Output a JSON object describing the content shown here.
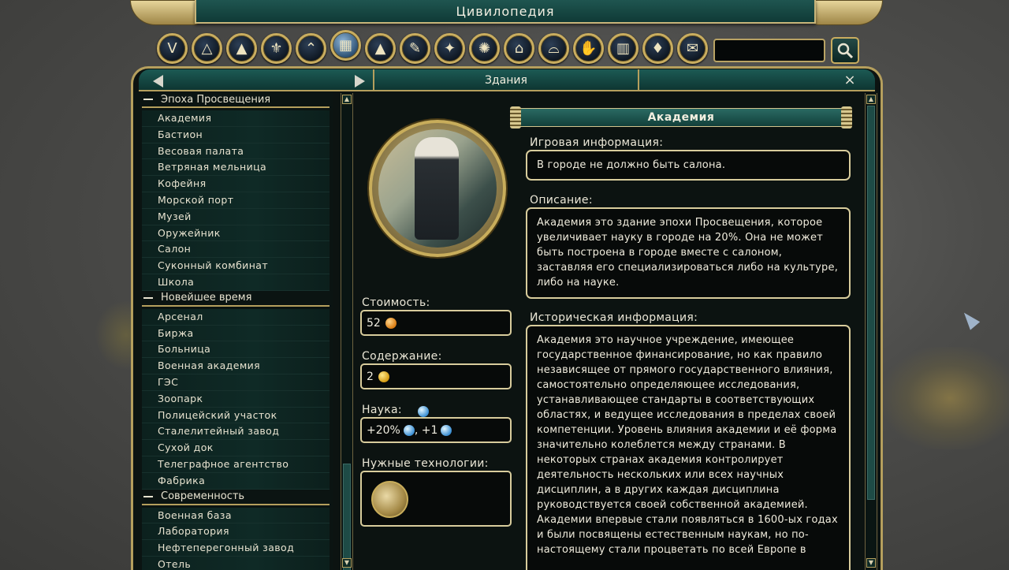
{
  "window_title": "Цивилопедия",
  "category_icons": [
    {
      "name": "civilization-icon",
      "glyph": "V"
    },
    {
      "name": "geometry-icon",
      "glyph": "△"
    },
    {
      "name": "terrain-icon",
      "glyph": "▲"
    },
    {
      "name": "unit-icon",
      "glyph": "⚜"
    },
    {
      "name": "promotion-icon",
      "glyph": "⌃"
    },
    {
      "name": "building-icon",
      "glyph": "▦",
      "active": true
    },
    {
      "name": "wonder-icon",
      "glyph": "▲"
    },
    {
      "name": "tech-icon",
      "glyph": "✎"
    },
    {
      "name": "leader-icon",
      "glyph": "✦"
    },
    {
      "name": "religion-icon",
      "glyph": "✺"
    },
    {
      "name": "government-icon",
      "glyph": "⌂"
    },
    {
      "name": "resource-icon",
      "glyph": "⌓"
    },
    {
      "name": "improvement-icon",
      "glyph": "✋"
    },
    {
      "name": "city-icon",
      "glyph": "▥"
    },
    {
      "name": "gem-icon",
      "glyph": "♦"
    },
    {
      "name": "map-icon",
      "glyph": "✉"
    }
  ],
  "search": {
    "placeholder": ""
  },
  "header": {
    "title": "Здания",
    "close": "×"
  },
  "list_groups": [
    {
      "title": "Эпоха Просвещения",
      "items": [
        "Академия",
        "Бастион",
        "Весовая палата",
        "Ветряная мельница",
        "Кофейня",
        "Морской порт",
        "Музей",
        "Оружейник",
        "Салон",
        "Суконный комбинат",
        "Школа"
      ]
    },
    {
      "title": "Новейшее время",
      "items": [
        "Арсенал",
        "Биржа",
        "Больница",
        "Военная академия",
        "ГЭС",
        "Зоопарк",
        "Полицейский участок",
        "Сталелитейный завод",
        "Сухой док",
        "Телеграфное агентство",
        "Фабрика"
      ]
    },
    {
      "title": "Современность",
      "items": [
        "Военная база",
        "Лаборатория",
        "Нефтеперегонный завод",
        "Отель"
      ]
    }
  ],
  "detail": {
    "name": "Академия",
    "cost_label": "Стоимость:",
    "cost_value": "52",
    "upkeep_label": "Содержание:",
    "upkeep_value": "2",
    "science_label": "Наука:",
    "science_value_a": "+20%",
    "science_sep": ", +1",
    "tech_label": "Нужные технологии:",
    "game_info_label": "Игровая информация:",
    "game_info": "В городе не должно быть салона.",
    "description_label": "Описание:",
    "description": "Академия это здание эпохи Просвещения, которое увеличивает  науку в городе на 20%. Она не может быть построена в городе вместе с салоном, заставляя его специализироваться либо на культуре, либо на науке.",
    "history_label": "Историческая информация:",
    "history": "Академия это научное учреждение, имеющее государственное финансирование, но как правило независящее от прямого государственного влияния, самостоятельно определяющее исследования, устанавливающее стандарты в соответствующих областях, и ведущее исследования в пределах своей компетенции. Уровень влияния академии и её форма значительно колеблется между странами. В некоторых странах академия контролирует деятельность нескольких или всех научных дисциплин, а в других каждая дисциплина руководствуется своей собственной академией. Академии впервые стали появляться в 1600-ых годах и были посвящены естественным наукам, но по-настоящему стали процветать по всей Европе в"
  },
  "colors": {
    "panel": "#0c1311",
    "frame": "#b59f5d",
    "header": "#1c5a54",
    "text": "#e8e3d0"
  }
}
